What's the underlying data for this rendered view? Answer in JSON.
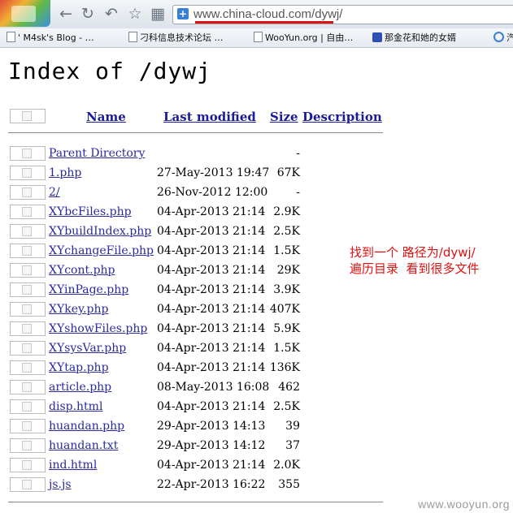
{
  "browser": {
    "url": "www.china-cloud.com/dywj/",
    "bookmarks": [
      {
        "label": "M4sk's Blog - …",
        "icon": "page-icon"
      },
      {
        "label": "刁科信息技术论坛 …",
        "icon": "page-icon"
      },
      {
        "label": "WooYun.org | 自由…",
        "icon": "page-icon"
      },
      {
        "label": "那金花和她的女婿",
        "icon": "paw-icon"
      },
      {
        "label": "汽",
        "icon": "ring-icon"
      }
    ],
    "highlight_color": "#e01010"
  },
  "listing": {
    "title": "Index of /dywj",
    "headers": {
      "name": "Name",
      "modified": "Last modified",
      "size": "Size",
      "description": "Description"
    },
    "rows": [
      {
        "name": "Parent Directory",
        "modified": "",
        "size": "-"
      },
      {
        "name": "1.php",
        "modified": "27-May-2013 19:47",
        "size": "67K"
      },
      {
        "name": "2/",
        "modified": "26-Nov-2012 12:00",
        "size": "-"
      },
      {
        "name": "XYbcFiles.php",
        "modified": "04-Apr-2013 21:14",
        "size": "2.9K"
      },
      {
        "name": "XYbuildIndex.php",
        "modified": "04-Apr-2013 21:14",
        "size": "2.5K"
      },
      {
        "name": "XYchangeFile.php",
        "modified": "04-Apr-2013 21:14",
        "size": "1.5K"
      },
      {
        "name": "XYcont.php",
        "modified": "04-Apr-2013 21:14",
        "size": "29K"
      },
      {
        "name": "XYinPage.php",
        "modified": "04-Apr-2013 21:14",
        "size": "3.9K"
      },
      {
        "name": "XYkey.php",
        "modified": "04-Apr-2013 21:14",
        "size": "407K"
      },
      {
        "name": "XYshowFiles.php",
        "modified": "04-Apr-2013 21:14",
        "size": "5.9K"
      },
      {
        "name": "XYsysVar.php",
        "modified": "04-Apr-2013 21:14",
        "size": "1.5K"
      },
      {
        "name": "XYtap.php",
        "modified": "04-Apr-2013 21:14",
        "size": "136K"
      },
      {
        "name": "article.php",
        "modified": "08-May-2013 16:08",
        "size": "462"
      },
      {
        "name": "disp.html",
        "modified": "04-Apr-2013 21:14",
        "size": "2.5K"
      },
      {
        "name": "huandan.php",
        "modified": "29-Apr-2013 14:13",
        "size": "39"
      },
      {
        "name": "huandan.txt",
        "modified": "29-Apr-2013 14:12",
        "size": "37"
      },
      {
        "name": "ind.html",
        "modified": "04-Apr-2013 21:14",
        "size": "2.0K"
      },
      {
        "name": "js.js",
        "modified": "22-Apr-2013 16:22",
        "size": "355"
      }
    ]
  },
  "annotation": {
    "line1": "找到一个 路径为/dywj/",
    "line2": "遍历目录  看到很多文件"
  },
  "watermark": "www.wooyun.org"
}
